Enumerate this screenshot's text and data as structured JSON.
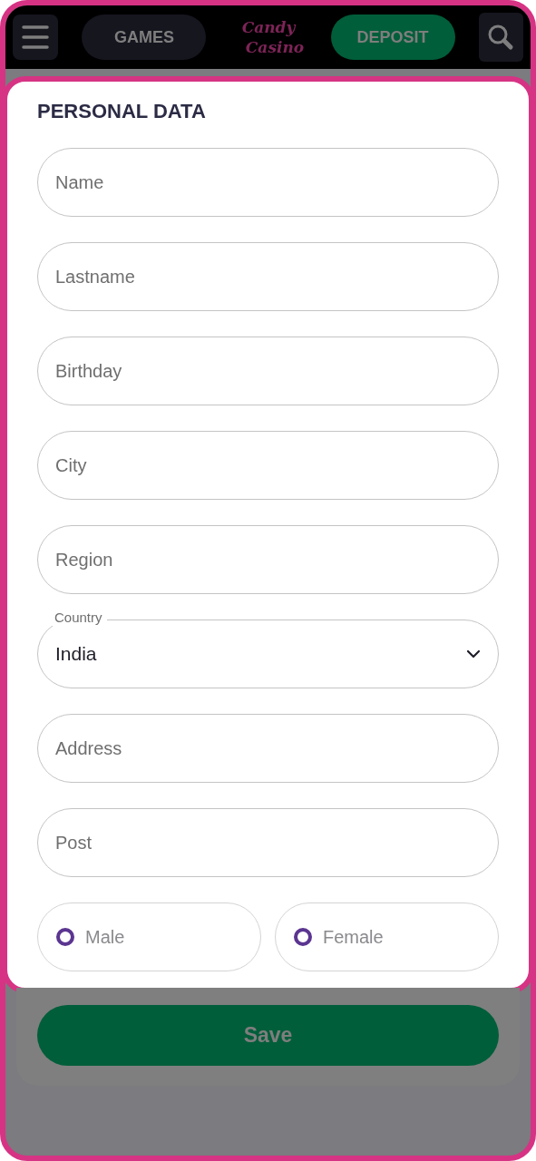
{
  "header": {
    "games_button": "GAMES",
    "logo": [
      "Candy",
      "Casino"
    ],
    "deposit_button": "DEPOSIT"
  },
  "form": {
    "title": "PERSONAL DATA",
    "fields": [
      {
        "kind": "text",
        "placeholder": "Name"
      },
      {
        "kind": "text",
        "placeholder": "Lastname"
      },
      {
        "kind": "text",
        "placeholder": "Birthday"
      },
      {
        "kind": "text",
        "placeholder": "City"
      },
      {
        "kind": "text",
        "placeholder": "Region"
      },
      {
        "kind": "select",
        "label": "Country",
        "value": "India"
      },
      {
        "kind": "text",
        "placeholder": "Address"
      },
      {
        "kind": "text",
        "placeholder": "Post"
      }
    ],
    "gender": [
      {
        "label": "Male",
        "selected": false
      },
      {
        "label": "Female",
        "selected": false
      }
    ]
  },
  "save_button": "Save"
}
